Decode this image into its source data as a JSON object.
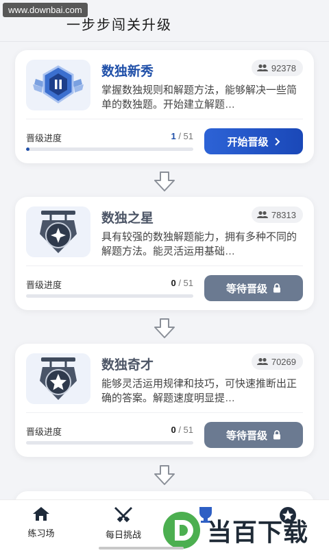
{
  "watermark_top": "www.downbai.com",
  "page_title": "一步步闯关升级",
  "progress_label": "晋级进度",
  "levels": [
    {
      "title": "数独新秀",
      "count": "92378",
      "desc": "掌握数独规则和解题方法，能够解决一些简单的数独题。开始建立解题…",
      "progress_current": "1",
      "progress_total": "/ 51",
      "progress_fraction": 0.0196,
      "button": "开始晋级",
      "button_icon": "chevron-right-icon",
      "state": "active"
    },
    {
      "title": "数独之星",
      "count": "78313",
      "desc": "具有较强的数独解题能力，拥有多种不同的解题方法。能灵活运用基础…",
      "progress_current": "0",
      "progress_total": "/ 51",
      "progress_fraction": 0,
      "button": "等待晋级",
      "button_icon": "lock-icon",
      "state": "locked"
    },
    {
      "title": "数独奇才",
      "count": "70269",
      "desc": "能够灵活运用规律和技巧，可快速推断出正确的答案。解题速度明显提…",
      "progress_current": "0",
      "progress_total": "/ 51",
      "progress_fraction": 0,
      "button": "等待晋级",
      "button_icon": "lock-icon",
      "state": "locked"
    }
  ],
  "tabs": [
    {
      "label": "练习场",
      "icon": "home-icon"
    },
    {
      "label": "每日挑战",
      "icon": "crossed-swords-icon"
    },
    {
      "label": "",
      "icon": "trophy-icon"
    },
    {
      "label": "",
      "icon": "star-badge-icon"
    }
  ],
  "watermark_logo": "当百下载",
  "colors": {
    "accent": "#1f4fa8",
    "locked": "#6b7a91"
  }
}
